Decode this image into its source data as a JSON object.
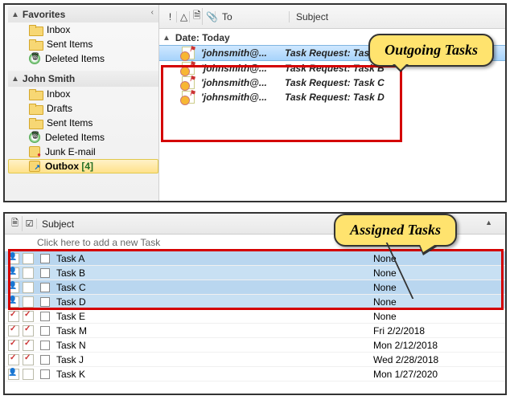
{
  "nav": {
    "sections": [
      {
        "title": "Favorites",
        "items": [
          {
            "label": "Inbox",
            "icon": "folder"
          },
          {
            "label": "Sent Items",
            "icon": "folder"
          },
          {
            "label": "Deleted Items",
            "icon": "trash"
          }
        ]
      },
      {
        "title": "John Smith",
        "items": [
          {
            "label": "Inbox",
            "icon": "folder"
          },
          {
            "label": "Drafts",
            "icon": "folder"
          },
          {
            "label": "Sent Items",
            "icon": "folder"
          },
          {
            "label": "Deleted Items",
            "icon": "trash"
          },
          {
            "label": "Junk E-mail",
            "icon": "junk"
          },
          {
            "label": "Outbox",
            "icon": "outbox",
            "count": "[4]",
            "selected": true
          }
        ]
      }
    ]
  },
  "msg_headers": {
    "to": "To",
    "subject": "Subject"
  },
  "icons": {
    "importance": "!",
    "reminder": "🔔",
    "item": "🗎",
    "attach": "📎",
    "checkbox": "☑"
  },
  "date_group": "Date: Today",
  "messages": [
    {
      "to": "'johnsmith@...",
      "subject": "Task Request: Task A",
      "selected": true
    },
    {
      "to": "'johnsmith@...",
      "subject": "Task Request: Task B"
    },
    {
      "to": "'johnsmith@...",
      "subject": "Task Request: Task C"
    },
    {
      "to": "'johnsmith@...",
      "subject": "Task Request: Task D"
    }
  ],
  "callouts": {
    "outgoing": "Outgoing Tasks",
    "assigned": "Assigned Tasks"
  },
  "task_header": {
    "subject": "Subject"
  },
  "new_task": "Click here to add a new Task",
  "tasks": [
    {
      "subject": "Task A",
      "due": "None",
      "hl": true
    },
    {
      "subject": "Task B",
      "due": "None",
      "hl": true
    },
    {
      "subject": "Task C",
      "due": "None",
      "hl": true
    },
    {
      "subject": "Task D",
      "due": "None",
      "hl": true
    },
    {
      "subject": "Task E",
      "due": "None"
    },
    {
      "subject": "Task M",
      "due": "Fri 2/2/2018"
    },
    {
      "subject": "Task N",
      "due": "Mon 2/12/2018"
    },
    {
      "subject": "Task J",
      "due": "Wed 2/28/2018"
    },
    {
      "subject": "Task K",
      "due": "Mon 1/27/2020"
    }
  ]
}
